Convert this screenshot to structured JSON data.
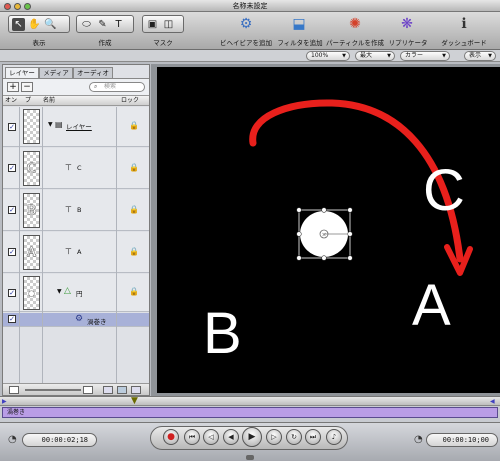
{
  "window": {
    "title": "名称未設定"
  },
  "toolbar": {
    "groups": [
      {
        "label": "表示"
      },
      {
        "label": "作成"
      },
      {
        "label": "マスク"
      }
    ],
    "actions": [
      {
        "label": "ビヘイビアを追加",
        "icon": "gear-icon"
      },
      {
        "label": "フィルタを追加",
        "icon": "filter-icon"
      },
      {
        "label": "パーティクルを作成",
        "icon": "particles-icon"
      },
      {
        "label": "リプリケータ",
        "icon": "replicator-icon"
      },
      {
        "label": "ダッシュボード",
        "icon": "info-icon"
      }
    ]
  },
  "options": {
    "zoom": "100%",
    "quality": "最大",
    "channels": "カラー",
    "display": "表示"
  },
  "panel": {
    "tabs": [
      "レイヤー",
      "メディア",
      "オーディオ"
    ],
    "search_placeholder": "検索",
    "columns": {
      "on": "オン",
      "preview": "プ",
      "name": "名前",
      "lock": "ロック"
    },
    "rows": [
      {
        "name": "レイヤー",
        "thumb": "",
        "kind": "group"
      },
      {
        "name": "C",
        "thumb": "C",
        "kind": "text"
      },
      {
        "name": "B",
        "thumb": "B",
        "kind": "text"
      },
      {
        "name": "A",
        "thumb": "A",
        "kind": "text"
      },
      {
        "name": "円",
        "thumb": "●",
        "kind": "shape"
      },
      {
        "name": "渦巻き",
        "thumb": "",
        "kind": "behavior"
      }
    ]
  },
  "canvas": {
    "letters": [
      "C",
      "A",
      "B"
    ],
    "arrow_color": "#e8201c"
  },
  "timeline": {
    "track_label": "渦巻き"
  },
  "transport": {
    "current_time": "00:00:02;18",
    "duration": "00:00:10;00"
  },
  "colors": {
    "track": "#b99de6",
    "selected_row": "#a8b1d8"
  }
}
